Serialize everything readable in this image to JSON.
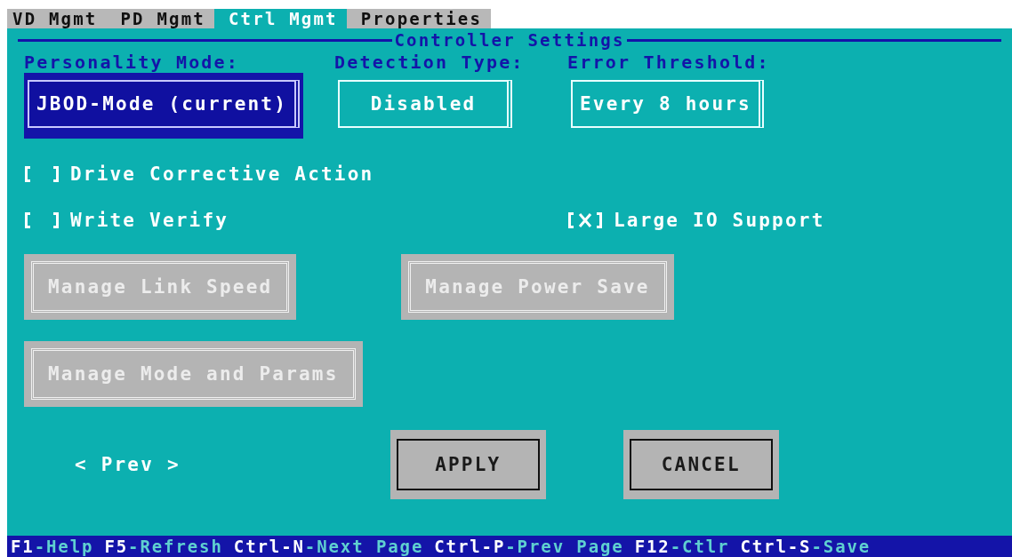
{
  "tabs": [
    {
      "label": "VD Mgmt",
      "selected": false
    },
    {
      "label": "PD Mgmt",
      "selected": false
    },
    {
      "label": "Ctrl Mgmt",
      "selected": true
    },
    {
      "label": "Properties",
      "selected": false
    }
  ],
  "section": {
    "title": "Controller Settings"
  },
  "selectors": [
    {
      "label": "Personality Mode:",
      "value": "JBOD-Mode (current)",
      "focused": true
    },
    {
      "label": "Detection Type:",
      "value": "Disabled",
      "focused": false
    },
    {
      "label": "Error Threshold:",
      "value": "Every 8 hours",
      "focused": false
    }
  ],
  "option_rows": [
    {
      "left": {
        "label": "Drive Corrective Action",
        "checked": false
      }
    },
    {
      "left": {
        "label": "Write Verify",
        "checked": false
      },
      "right": {
        "label": "Large IO Support",
        "checked": true
      }
    }
  ],
  "manage_rows": [
    [
      {
        "label": "Manage Link Speed",
        "disabled": true
      },
      {
        "label": "Manage Power Save",
        "disabled": true
      }
    ],
    [
      {
        "label": "Manage Mode and Params",
        "disabled": true
      }
    ]
  ],
  "pager": "< Prev >",
  "actions": [
    {
      "label": "APPLY"
    },
    {
      "label": "CANCEL"
    }
  ],
  "status_bar": [
    {
      "key": "F1",
      "text": "-Help"
    },
    {
      "key": "F5",
      "text": "-Refresh"
    },
    {
      "key": "Ctrl-N",
      "text": "-Next Page"
    },
    {
      "key": "Ctrl-P",
      "text": "-Prev Page"
    },
    {
      "key": "F12",
      "text": "-Ctlr"
    },
    {
      "key": "Ctrl-S",
      "text": "-Save"
    }
  ]
}
